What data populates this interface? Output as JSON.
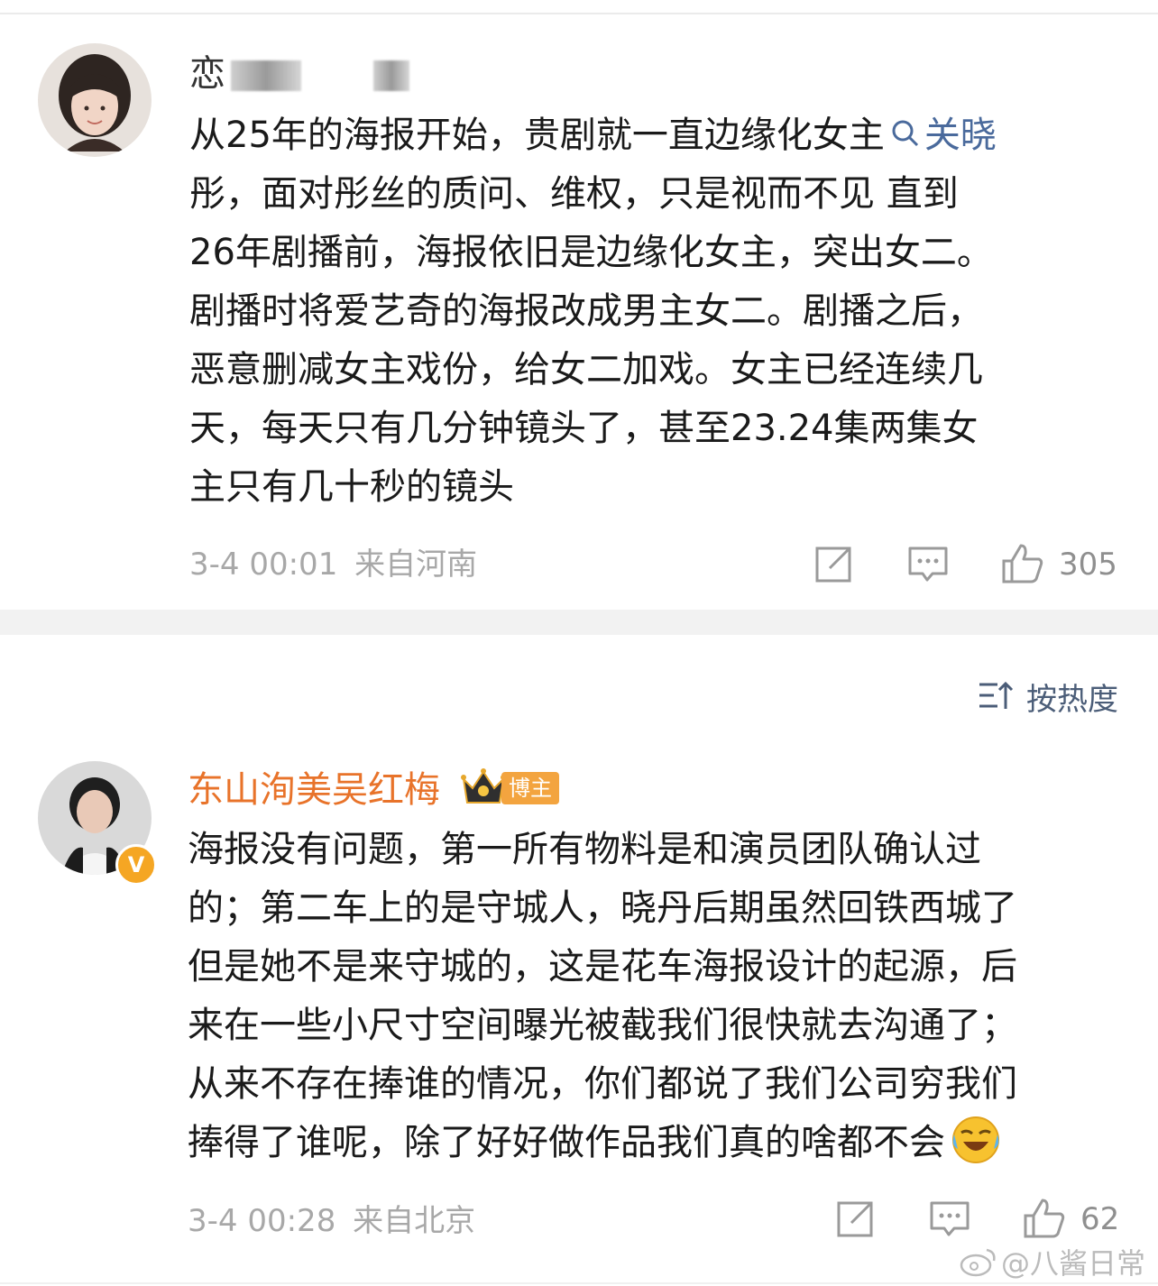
{
  "comments": [
    {
      "username": "恋",
      "text_lines": [
        "从25年的海报开始，贵剧就一直边缘化女主",
        "彤，面对彤丝的质问、维权，只是视而不见 直到",
        " 26年剧播前，海报依旧是边缘化女主，突出女二。",
        "剧播时将爱艺奇的海报改成男主女二。剧播之后，",
        "恶意删减女主戏份，给女二加戏。女主已经连续几",
        "天，每天只有几分钟镜头了，甚至23.24集两集女",
        "主只有几十秒的镜头"
      ],
      "topic_link": "关晓",
      "time": "3-4 00:01",
      "location": "来自河南",
      "likes": "305"
    },
    {
      "username": "东山洵美吴红梅",
      "badge": "博主",
      "verified_badge": "V",
      "text_lines": [
        "海报没有问题，第一所有物料是和演员团队确认过",
        "的；第二车上的是守城人，晓丹后期虽然回铁西城了",
        "但是她不是来守城的，这是花车海报设计的起源，后",
        "来在一些小尺寸空间曝光被截我们很快就去沟通了；",
        "从来不存在捧谁的情况，你们都说了我们公司穷我们",
        "捧得了谁呢，除了好好做作品我们真的啥都不会"
      ],
      "time": "3-4 00:28",
      "location": "来自北京",
      "likes": "62"
    }
  ],
  "sort_label": "按热度",
  "watermark": "@八酱日常",
  "colors": {
    "link": "#4a6a9c",
    "orange_name": "#e8732a",
    "meta": "#a8a8a8",
    "badge": "#f3a43f"
  },
  "icons": [
    "search-icon",
    "share-icon",
    "comment-icon",
    "like-icon",
    "sort-icon",
    "crown-icon",
    "laughing-crying-emoji",
    "weibo-logo-icon"
  ]
}
